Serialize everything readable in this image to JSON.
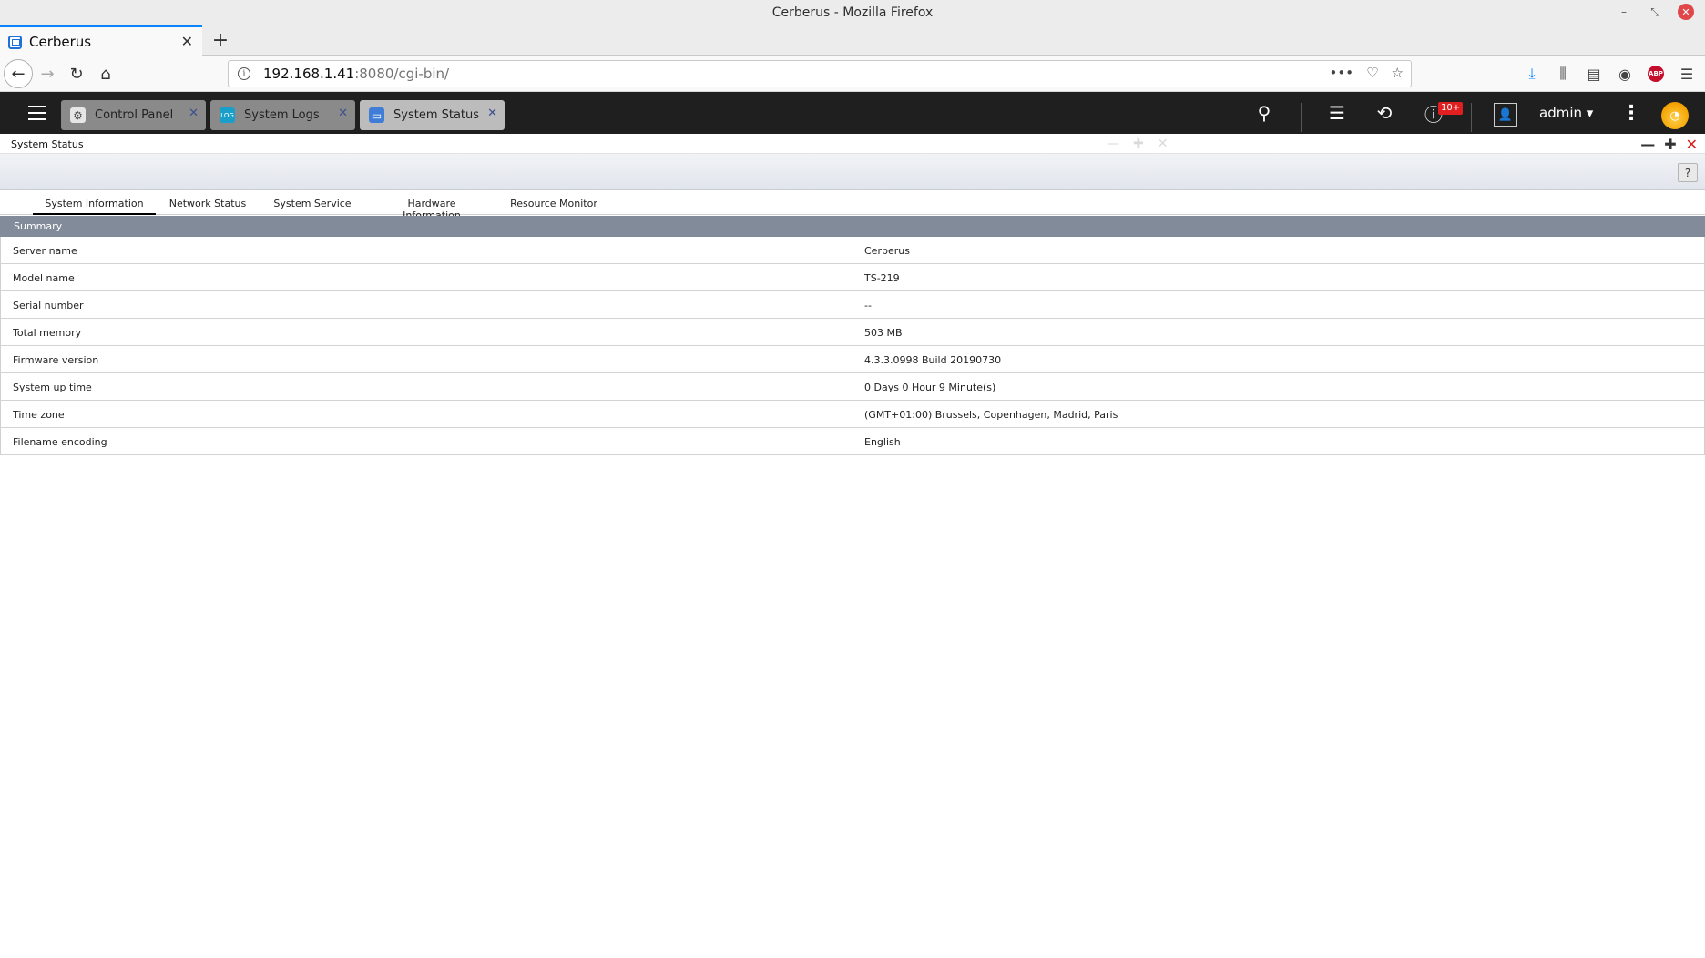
{
  "window": {
    "title": "Cerberus - Mozilla Firefox"
  },
  "browser": {
    "tab_title": "Cerberus",
    "url_host": "192.168.1.41",
    "url_rest": ":8080/cgi-bin/"
  },
  "qts": {
    "app_tabs": [
      {
        "label": "Control Panel",
        "icon": "gear-icon"
      },
      {
        "label": "System Logs",
        "icon": "log-icon"
      },
      {
        "label": "System Status",
        "icon": "monitor-icon"
      }
    ],
    "notification_badge": "10+",
    "username": "admin"
  },
  "app": {
    "title": "System Status",
    "help_label": "?",
    "tabs": [
      "System Information",
      "Network Status",
      "System Service",
      "Hardware Information",
      "Resource Monitor"
    ],
    "active_tab": "System Information",
    "section_title": "Summary",
    "rows": [
      {
        "label": "Server name",
        "value": "Cerberus"
      },
      {
        "label": "Model name",
        "value": "TS-219"
      },
      {
        "label": "Serial number",
        "value": "--"
      },
      {
        "label": "Total memory",
        "value": "503 MB"
      },
      {
        "label": "Firmware version",
        "value": "4.3.3.0998 Build 20190730"
      },
      {
        "label": "System up time",
        "value": "0 Days 0 Hour 9 Minute(s)"
      },
      {
        "label": "Time zone",
        "value": "(GMT+01:00) Brussels, Copenhagen, Madrid, Paris"
      },
      {
        "label": "Filename encoding",
        "value": "English"
      }
    ]
  },
  "colors": {
    "qts_topbar": "#1f1f1f",
    "summary_header": "#828b99",
    "firefox_accent": "#0a84ff",
    "close_red": "#d81e1e"
  }
}
